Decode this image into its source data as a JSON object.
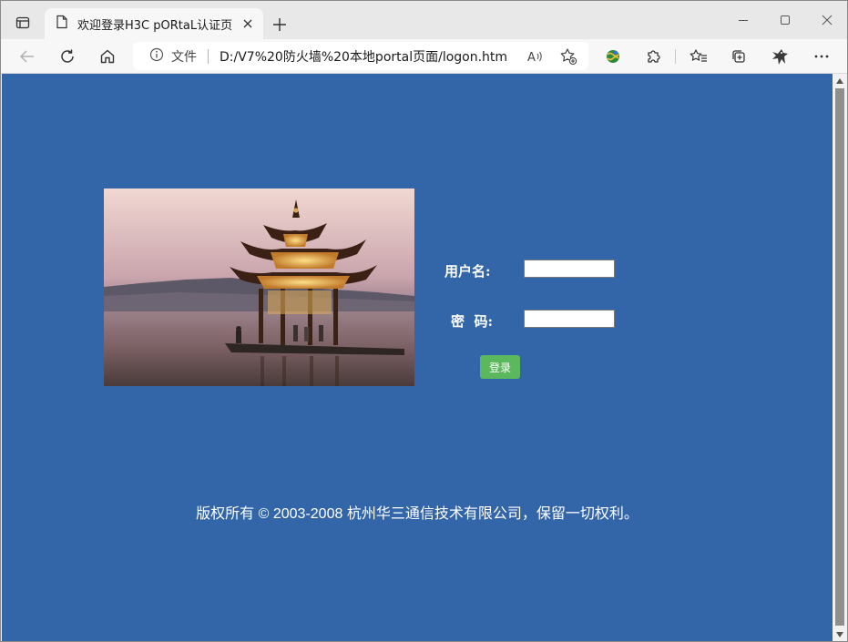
{
  "browser": {
    "tab": {
      "title": "欢迎登录H3C pORtaL认证页面"
    },
    "address": {
      "info_label": "文件",
      "url": "D:/V7%20防火墙%20本地portal页面/logon.htm"
    },
    "icons": {
      "tab_actions": "tab-actions-icon",
      "page": "page-icon",
      "close": "close-icon",
      "new_tab": "plus-icon",
      "minimize": "minimize-icon",
      "maximize": "maximize-icon",
      "window_close": "window-close-icon",
      "back": "back-arrow-icon",
      "refresh": "refresh-icon",
      "home": "home-icon",
      "info": "info-icon",
      "read_aloud": "read-aloud-icon",
      "favorite_add": "favorite-add-icon",
      "extension_globe": "globe-extension-icon",
      "extensions": "puzzle-icon",
      "favorites": "favorites-icon",
      "collections": "collections-icon",
      "profile": "profile-icon",
      "more": "more-icon"
    }
  },
  "page": {
    "background_color": "#3366a8",
    "form": {
      "username_label": "用户名:",
      "username_value": "",
      "password_label": "密  码:",
      "password_value": "",
      "login_button": "登录"
    },
    "copyright": "版权所有 © 2003-2008 杭州华三通信技术有限公司，保留一切权利。",
    "login_button_color": "#5cb85c"
  }
}
